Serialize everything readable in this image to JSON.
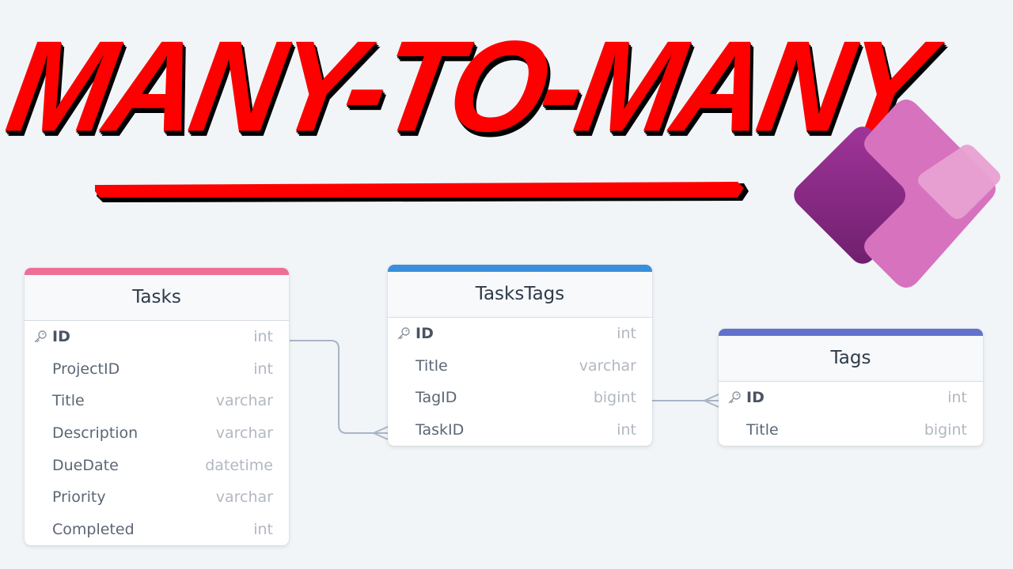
{
  "headline": "MANY-TO-MANY",
  "logo": {
    "name": "power-apps-logo",
    "colors": [
      "#8c2a86",
      "#d86fc0",
      "#e79dcf"
    ]
  },
  "tables": [
    {
      "name": "Tasks",
      "accent": "#ee6e96",
      "columns": [
        {
          "name": "ID",
          "type": "int",
          "pk": true
        },
        {
          "name": "ProjectID",
          "type": "int"
        },
        {
          "name": "Title",
          "type": "varchar"
        },
        {
          "name": "Description",
          "type": "varchar"
        },
        {
          "name": "DueDate",
          "type": "datetime"
        },
        {
          "name": "Priority",
          "type": "varchar"
        },
        {
          "name": "Completed",
          "type": "int"
        }
      ]
    },
    {
      "name": "TasksTags",
      "accent": "#3a8fdd",
      "columns": [
        {
          "name": "ID",
          "type": "int",
          "pk": true
        },
        {
          "name": "Title",
          "type": "varchar"
        },
        {
          "name": "TagID",
          "type": "bigint"
        },
        {
          "name": "TaskID",
          "type": "int"
        }
      ]
    },
    {
      "name": "Tags",
      "accent": "#6272cc",
      "columns": [
        {
          "name": "ID",
          "type": "int",
          "pk": true
        },
        {
          "name": "Title",
          "type": "bigint"
        }
      ]
    }
  ],
  "relationships": [
    {
      "from": "Tasks.ID",
      "to": "TasksTags.TaskID",
      "cardinality": "one-to-many"
    },
    {
      "from": "Tags.ID",
      "to": "TasksTags.TagID",
      "cardinality": "one-to-many"
    }
  ]
}
